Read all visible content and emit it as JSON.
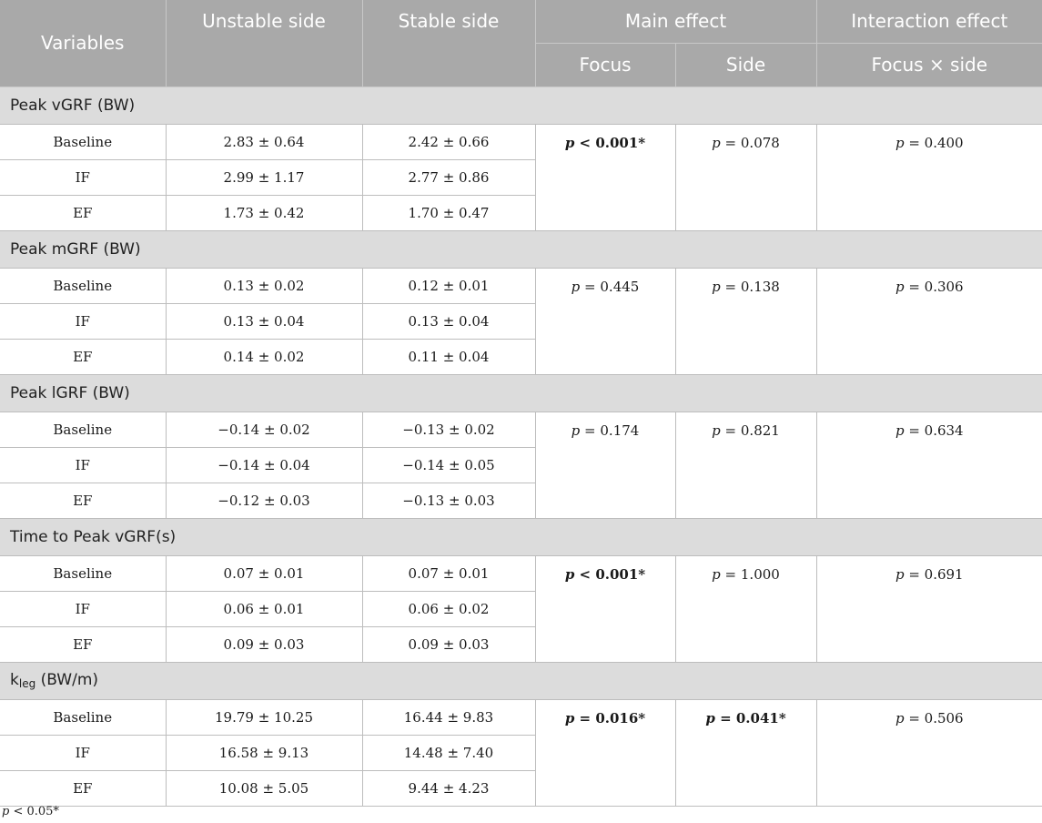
{
  "header": {
    "variables": "Variables",
    "unstable": "Unstable side",
    "stable": "Stable side",
    "main_effect": "Main effect",
    "interaction_effect": "Interaction effect",
    "focus": "Focus",
    "side": "Side",
    "focus_x_side": "Focus × side"
  },
  "groups": [
    {
      "title": "Peak vGRF (BW)",
      "rows": [
        {
          "label": "Baseline",
          "unstable": "2.83 ± 0.64",
          "stable": "2.42 ± 0.66"
        },
        {
          "label": "IF",
          "unstable": "2.99 ± 1.17",
          "stable": "2.77 ± 0.86"
        },
        {
          "label": "EF",
          "unstable": "1.73 ± 0.42",
          "stable": "1.70 ± 0.47"
        }
      ],
      "focus": {
        "p": "p",
        "text": " < 0.001*",
        "bold": true
      },
      "side": {
        "p": "p",
        "text": " = 0.078",
        "bold": false
      },
      "interaction": {
        "p": "p",
        "text": " = 0.400",
        "bold": false
      }
    },
    {
      "title": "Peak mGRF (BW)",
      "rows": [
        {
          "label": "Baseline",
          "unstable": "0.13 ± 0.02",
          "stable": "0.12 ± 0.01"
        },
        {
          "label": "IF",
          "unstable": "0.13 ± 0.04",
          "stable": "0.13 ± 0.04"
        },
        {
          "label": "EF",
          "unstable": "0.14 ± 0.02",
          "stable": "0.11 ± 0.04"
        }
      ],
      "focus": {
        "p": "p",
        "text": " = 0.445",
        "bold": false
      },
      "side": {
        "p": "p",
        "text": " = 0.138",
        "bold": false
      },
      "interaction": {
        "p": "p",
        "text": " = 0.306",
        "bold": false
      }
    },
    {
      "title": "Peak lGRF (BW)",
      "rows": [
        {
          "label": "Baseline",
          "unstable": "−0.14 ± 0.02",
          "stable": "−0.13 ± 0.02"
        },
        {
          "label": "IF",
          "unstable": "−0.14 ± 0.04",
          "stable": "−0.14 ± 0.05"
        },
        {
          "label": "EF",
          "unstable": "−0.12 ± 0.03",
          "stable": "−0.13 ± 0.03"
        }
      ],
      "focus": {
        "p": "p",
        "text": " = 0.174",
        "bold": false
      },
      "side": {
        "p": "p",
        "text": " = 0.821",
        "bold": false
      },
      "interaction": {
        "p": "p",
        "text": " = 0.634",
        "bold": false
      }
    },
    {
      "title": "Time to Peak vGRF(s)",
      "rows": [
        {
          "label": "Baseline",
          "unstable": "0.07 ± 0.01",
          "stable": "0.07 ± 0.01"
        },
        {
          "label": "IF",
          "unstable": "0.06 ± 0.01",
          "stable": "0.06 ± 0.02"
        },
        {
          "label": "EF",
          "unstable": "0.09 ± 0.03",
          "stable": "0.09 ± 0.03"
        }
      ],
      "focus": {
        "p": "p",
        "text": " < 0.001*",
        "bold": true
      },
      "side": {
        "p": "p",
        "text": " = 1.000",
        "bold": false
      },
      "interaction": {
        "p": "p",
        "text": " = 0.691",
        "bold": false
      }
    },
    {
      "title": "k",
      "title_sub": "leg",
      "title_rest": " (BW/m)",
      "rows": [
        {
          "label": "Baseline",
          "unstable": "19.79 ± 10.25",
          "stable": "16.44 ± 9.83"
        },
        {
          "label": "IF",
          "unstable": "16.58 ± 9.13",
          "stable": "14.48 ± 7.40"
        },
        {
          "label": "EF",
          "unstable": "10.08 ± 5.05",
          "stable": "9.44 ± 4.23"
        }
      ],
      "focus": {
        "p": "p",
        "text": " = 0.016*",
        "bold": true
      },
      "side": {
        "p": "p",
        "text": " = 0.041*",
        "bold": true
      },
      "interaction": {
        "p": "p",
        "text": " = 0.506",
        "bold": false
      }
    }
  ],
  "footnote": {
    "p": "p",
    "text": " < 0.05*"
  }
}
